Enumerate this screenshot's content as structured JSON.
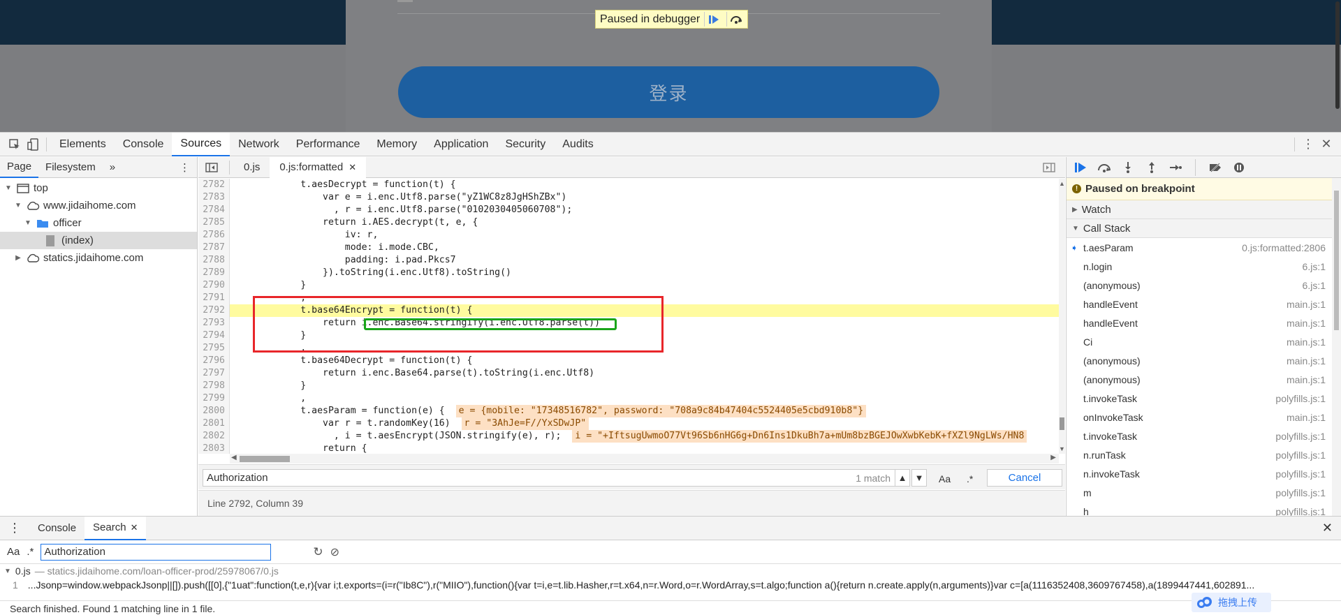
{
  "viewport": {
    "login_label": "登录",
    "paused_banner": "Paused in debugger"
  },
  "devtools_tabs": [
    "Elements",
    "Console",
    "Sources",
    "Network",
    "Performance",
    "Memory",
    "Application",
    "Security",
    "Audits"
  ],
  "navigator": {
    "tabs": [
      "Page",
      "Filesystem"
    ],
    "tree": {
      "top": "top",
      "domain1": "www.jidaihome.com",
      "folder": "officer",
      "file": "(index)",
      "domain2": "statics.jidaihome.com"
    }
  },
  "editor": {
    "tabs": [
      "0.js",
      "0.js:formatted"
    ],
    "lines": [
      {
        "n": "2782",
        "t": "            t.aesDecrypt = function(t) {"
      },
      {
        "n": "2783",
        "t": "                var e = i.enc.Utf8.parse(\"yZ1WC8z8JgHShZBx\")"
      },
      {
        "n": "2784",
        "t": "                  , r = i.enc.Utf8.parse(\"0102030405060708\");"
      },
      {
        "n": "2785",
        "t": "                return i.AES.decrypt(t, e, {"
      },
      {
        "n": "2786",
        "t": "                    iv: r,"
      },
      {
        "n": "2787",
        "t": "                    mode: i.mode.CBC,"
      },
      {
        "n": "2788",
        "t": "                    padding: i.pad.Pkcs7"
      },
      {
        "n": "2789",
        "t": "                }).toString(i.enc.Utf8).toString()"
      },
      {
        "n": "2790",
        "t": "            }"
      },
      {
        "n": "2791",
        "t": "            ,"
      },
      {
        "n": "2792",
        "t": "            t.base64Encrypt = function(t) {"
      },
      {
        "n": "2793",
        "t": "                return i.enc.Base64.stringify(i.enc.Utf8.parse(t))"
      },
      {
        "n": "2794",
        "t": "            }"
      },
      {
        "n": "2795",
        "t": "            ,"
      },
      {
        "n": "2796",
        "t": "            t.base64Decrypt = function(t) {"
      },
      {
        "n": "2797",
        "t": "                return i.enc.Base64.parse(t).toString(i.enc.Utf8)"
      },
      {
        "n": "2798",
        "t": "            }"
      },
      {
        "n": "2799",
        "t": "            ,"
      },
      {
        "n": "2800",
        "t": "            t.aesParam = function(e) {  "
      },
      {
        "n": "2801",
        "t": "                var r = t.randomKey(16)  "
      },
      {
        "n": "2802",
        "t": "                  , i = t.aesEncrypt(JSON.stringify(e), r);  "
      },
      {
        "n": "2803",
        "t": "                return {"
      },
      {
        "n": "2804",
        "t": ""
      }
    ],
    "inline_2800": "e = {mobile: \"17348516782\", password: \"708a9c84b47404c5524405e5cbd910b8\"}",
    "inline_2801": "r = \"3AhJe=F//YxSDwJP\"",
    "inline_2802": "i = \"+IftsugUwmoO77Vt96Sb6nHG6g+Dn6Ins1DkuBh7a+mUm8bzBGEJOwXwbKebK+fXZl9NgLWs/HN8",
    "find_query": "Authorization",
    "find_count": "1 match",
    "find_aa": "Aa",
    "find_re": ".*",
    "cancel": "Cancel",
    "status": "Line 2792, Column 39"
  },
  "debugger": {
    "paused": "Paused on breakpoint",
    "watch": "Watch",
    "call_stack": "Call Stack",
    "frames": [
      {
        "fn": "t.aesParam",
        "loc": "0.js:formatted:2806"
      },
      {
        "fn": "n.login",
        "loc": "6.js:1"
      },
      {
        "fn": "(anonymous)",
        "loc": "6.js:1"
      },
      {
        "fn": "handleEvent",
        "loc": "main.js:1"
      },
      {
        "fn": "handleEvent",
        "loc": "main.js:1"
      },
      {
        "fn": "Ci",
        "loc": "main.js:1"
      },
      {
        "fn": "(anonymous)",
        "loc": "main.js:1"
      },
      {
        "fn": "(anonymous)",
        "loc": "main.js:1"
      },
      {
        "fn": "t.invokeTask",
        "loc": "polyfills.js:1"
      },
      {
        "fn": "onInvokeTask",
        "loc": "main.js:1"
      },
      {
        "fn": "t.invokeTask",
        "loc": "polyfills.js:1"
      },
      {
        "fn": "n.runTask",
        "loc": "polyfills.js:1"
      },
      {
        "fn": "n.invokeTask",
        "loc": "polyfills.js:1"
      },
      {
        "fn": "m",
        "loc": "polyfills.js:1"
      },
      {
        "fn": "h",
        "loc": "polyfills.js:1"
      }
    ]
  },
  "drawer": {
    "tabs": [
      "Console",
      "Search"
    ],
    "aa": "Aa",
    "re": ".*",
    "query": "Authorization",
    "file_name": "0.js",
    "file_path": "— statics.jidaihome.com/loan-officer-prod/25978067/0.js",
    "result_line_no": "1",
    "result_text": "...Jsonp=window.webpackJsonp||[]).push([[0],{\"1uat\":function(t,e,r){var i;t.exports=(i=r(\"Ib8C\"),r(\"MIIO\"),function(){var t=i,e=t.lib.Hasher,r=t.x64,n=r.Word,o=r.WordArray,s=t.algo;function a(){return n.create.apply(n,arguments)}var c=[a(1116352408,3609767458),a(1899447441,602891...",
    "status": "Search finished.  Found 1 matching line in 1 file."
  },
  "upload_badge": "拖拽上传",
  "colors": {
    "accent": "#1a73e8",
    "highlight": "#fffb9f",
    "red_box": "#e8262a",
    "green_box": "#1aa51a"
  }
}
